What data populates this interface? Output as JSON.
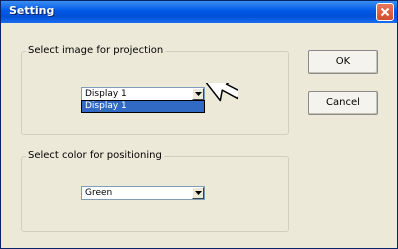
{
  "window": {
    "title": "Setting"
  },
  "projection_group": {
    "legend": "Select image for projection",
    "selected_value": "Display 1",
    "options": [
      "Display 1"
    ]
  },
  "color_group": {
    "legend": "Select color for positioning",
    "selected_value": "Green"
  },
  "buttons": {
    "ok_label": "OK",
    "cancel_label": "Cancel"
  },
  "colors": {
    "titlebar": "#0058e6",
    "selection": "#316ac5",
    "dialog_bg": "#ece9d8"
  }
}
